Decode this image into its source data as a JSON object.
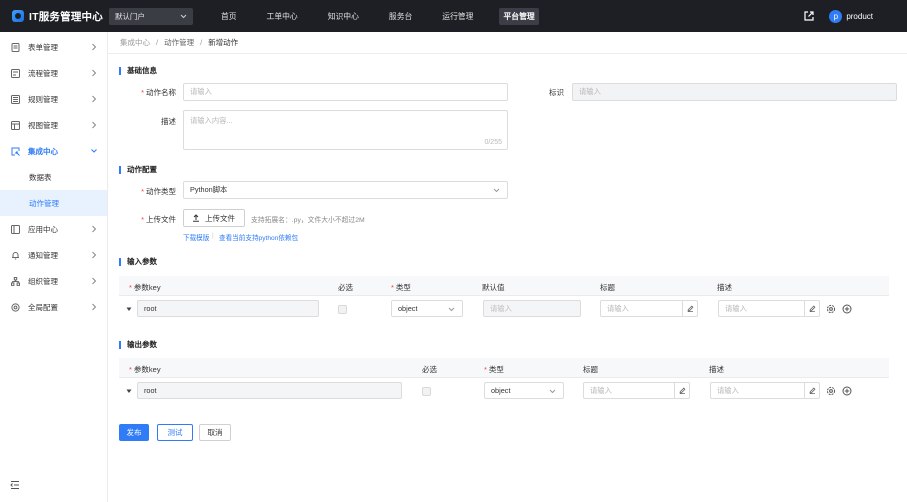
{
  "app": {
    "title": "IT服务管理中心",
    "portal": "默认门户"
  },
  "nav": [
    "首页",
    "工单中心",
    "知识中心",
    "服务台",
    "运行管理",
    "平台管理"
  ],
  "user": {
    "avatar_letter": "p",
    "name": "product"
  },
  "sidebar": {
    "items": [
      {
        "label": "表单管理",
        "icon": "form-icon"
      },
      {
        "label": "流程管理",
        "icon": "flow-icon"
      },
      {
        "label": "规则管理",
        "icon": "rule-icon"
      },
      {
        "label": "视图管理",
        "icon": "view-icon"
      },
      {
        "label": "集成中心",
        "icon": "integration-icon"
      },
      {
        "label": "应用中心",
        "icon": "app-icon"
      },
      {
        "label": "通知管理",
        "icon": "bell-icon"
      },
      {
        "label": "组织管理",
        "icon": "org-icon"
      },
      {
        "label": "全局配置",
        "icon": "gear-icon"
      }
    ],
    "sub_items": [
      "数据表",
      "动作管理"
    ]
  },
  "breadcrumb": [
    "集成中心",
    "动作管理",
    "新增动作"
  ],
  "basic": {
    "section": "基础信息",
    "name_label": "动作名称",
    "name_placeholder": "请输入",
    "id_label": "标识",
    "id_placeholder": "请输入",
    "desc_label": "描述",
    "desc_placeholder": "请输入内容...",
    "desc_counter": "0/255"
  },
  "config": {
    "section": "动作配置",
    "type_label": "动作类型",
    "type_value": "Python脚本",
    "upload_label": "上传文件",
    "upload_button": "上传文件",
    "upload_hint": "支持拓展名：.py，文件大小不超过2M",
    "link_download": "下载模版",
    "link_sep": "|",
    "link_deps": "查看当前支持python依赖包"
  },
  "input_params": {
    "section": "输入参数",
    "headers": [
      "参数key",
      "必选",
      "类型",
      "默认值",
      "标题",
      "描述"
    ],
    "row": {
      "key": "root",
      "type": "object",
      "default_placeholder": "请输入",
      "title_placeholder": "请输入",
      "desc_placeholder": "请输入"
    }
  },
  "output_params": {
    "section": "输出参数",
    "headers": [
      "参数key",
      "必选",
      "类型",
      "标题",
      "描述"
    ],
    "row": {
      "key": "root",
      "type": "object",
      "title_placeholder": "请输入",
      "desc_placeholder": "请输入"
    }
  },
  "actions": {
    "publish": "发布",
    "test": "测试",
    "cancel": "取消"
  },
  "colors": {
    "accent": "#2f7cf6",
    "required": "#f04545",
    "topbar": "#1d1f24"
  }
}
